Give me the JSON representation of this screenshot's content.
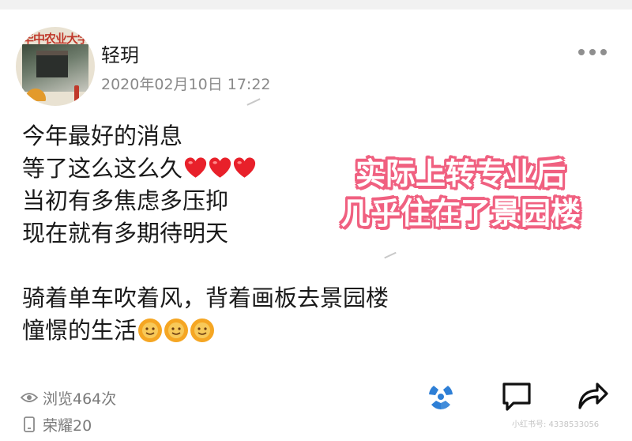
{
  "avatar": {
    "school_name": "华中农业大学"
  },
  "post": {
    "username": "轻玥",
    "timestamp": "2020年02月10日 17:22",
    "lines": {
      "l1": "今年最好的消息",
      "l2": "等了这么这么久",
      "l3": "当初有多焦虑多压抑",
      "l4": "现在就有多期待明天",
      "l5": "骑着单车吹着风，背着画板去景园楼",
      "l6": "憧憬的生活"
    },
    "emojis": {
      "line2": [
        "red-heart",
        "red-heart",
        "red-heart"
      ],
      "line6": [
        "sun-face",
        "sun-face",
        "sun-face"
      ]
    }
  },
  "overlay": {
    "line1": "实际上转专业后",
    "line2": "几乎住在了景园楼"
  },
  "stats": {
    "views": "浏览464次",
    "device": "荣耀20"
  },
  "actions": {
    "icons": [
      "share-to-friends-icon",
      "comment-icon",
      "forward-icon"
    ]
  },
  "watermark": "小红书号: 4338533056",
  "colors": {
    "overlay_outline": "#f06080",
    "accent_blue": "#2e7fd6",
    "heart": "#e8202a"
  }
}
